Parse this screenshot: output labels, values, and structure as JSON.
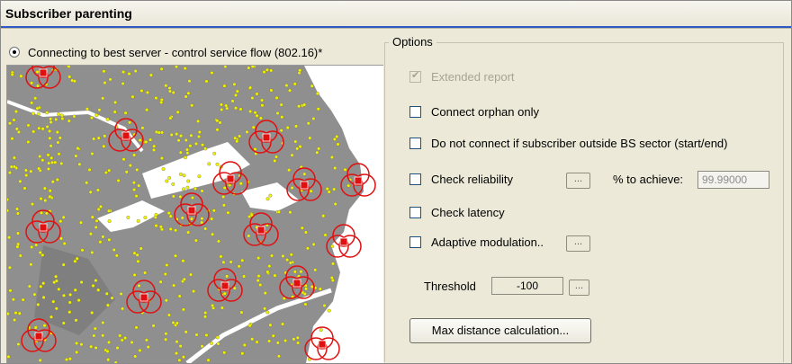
{
  "window": {
    "title": "Subscriber parenting"
  },
  "radio": {
    "label": "Connecting to best server - control service flow (802.16)*",
    "selected": true
  },
  "options": {
    "legend": "Options",
    "extended_report": {
      "label": "Extended report",
      "checked": true,
      "disabled": true
    },
    "connect_orphan": {
      "label": "Connect orphan only",
      "checked": false
    },
    "do_not_connect": {
      "label": "Do not connect if subscriber outside BS sector (start/end)",
      "checked": false
    },
    "check_reliability": {
      "label": "Check reliability",
      "checked": false,
      "button_label": "...",
      "achieve_label": "% to achieve:",
      "achieve_value": "99.99000"
    },
    "check_latency": {
      "label": "Check latency",
      "checked": false
    },
    "adaptive_modulation": {
      "label": "Adaptive modulation..",
      "checked": false,
      "button_label": "..."
    },
    "threshold": {
      "label": "Threshold",
      "value": "-100",
      "button_label": "..."
    },
    "max_distance_button": "Max distance calculation..."
  },
  "colors": {
    "terrain": "#8f8f8f",
    "subscriber": "#f2f200",
    "base_station": "#e01010",
    "title_accent": "#3059c8"
  }
}
